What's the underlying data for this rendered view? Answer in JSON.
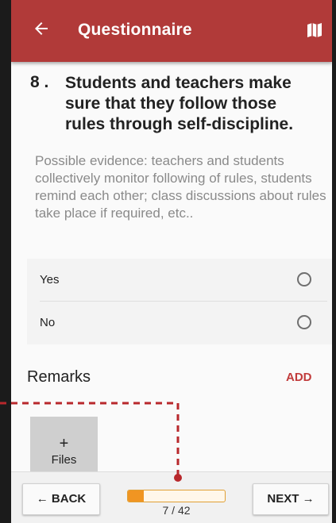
{
  "header": {
    "title": "Questionnaire",
    "back_icon": "arrow-left-icon",
    "map_icon": "map-icon",
    "color": "#b13a39"
  },
  "question": {
    "number": "8 .",
    "text": "Students and teachers make sure that they follow those rules through self-discipline.",
    "evidence": "Possible evidence: teachers and students collectively monitor following of rules, students remind each other; class discussions about rules take place if required, etc.."
  },
  "options": [
    {
      "label": "Yes",
      "selected": false
    },
    {
      "label": "No",
      "selected": false
    }
  ],
  "remarks": {
    "title": "Remarks",
    "add_label": "ADD"
  },
  "files": {
    "plus": "+",
    "label": "Files"
  },
  "footer": {
    "back_label": "← BACK",
    "next_label": "NEXT →",
    "progress_text": "7 / 42",
    "progress_fraction": 0.167,
    "progress_color": "#f09522"
  }
}
